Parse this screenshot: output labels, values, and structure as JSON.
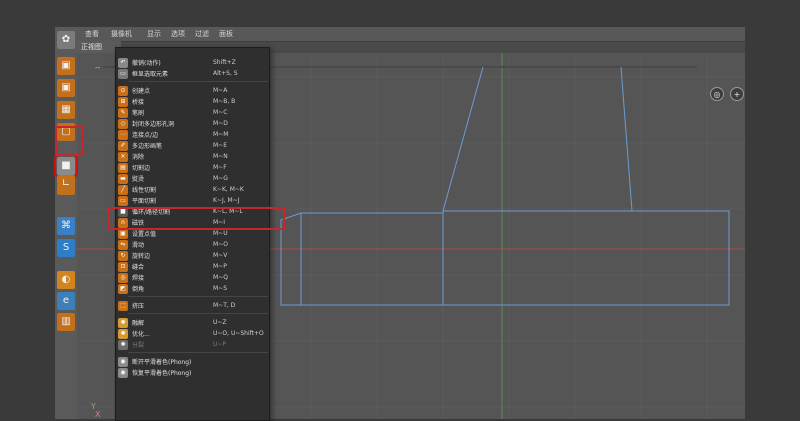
{
  "menubar": [
    "查看",
    "摄像机",
    "显示",
    "选项",
    "过滤",
    "面板"
  ],
  "view_tab": "正视图",
  "viewport": {
    "axis_label_x": "X",
    "axis_label_y": "Y",
    "nav_buttons": [
      "◎",
      "+"
    ]
  },
  "toolbar": {
    "icons": [
      {
        "name": "logo-icon",
        "color": "#7b7b7b",
        "glyph": "✿"
      },
      {
        "name": "cube-1-icon",
        "color": "#c3701d",
        "glyph": "▣"
      },
      {
        "name": "cube-2-icon",
        "color": "#c3701d",
        "glyph": "▣"
      },
      {
        "name": "grid-icon",
        "color": "#c3701d",
        "glyph": "▦"
      },
      {
        "name": "box-icon",
        "color": "#c3701d",
        "glyph": "▢"
      },
      {
        "name": "cube-tool-icon",
        "color": "#8a8a8a",
        "glyph": "■"
      },
      {
        "name": "cube-3-icon",
        "color": "#c3701d",
        "glyph": "▤"
      },
      {
        "name": "angle-icon",
        "color": "#c3701d",
        "glyph": "∟"
      },
      {
        "name": "mouse-icon",
        "color": "#3a80c9",
        "glyph": "⌘"
      },
      {
        "name": "s-icon",
        "color": "#2d7dc7",
        "glyph": "S"
      },
      {
        "name": "magnet-icon",
        "color": "#d2851f",
        "glyph": "◐"
      },
      {
        "name": "mesh-e-icon",
        "color": "#3f7fb8",
        "glyph": "e"
      },
      {
        "name": "mesh-icon",
        "color": "#c3701d",
        "glyph": "▥"
      }
    ]
  },
  "menu": {
    "items": [
      {
        "name": "undo-action",
        "label": "撤销(动作)",
        "shortcut": "Shift+Z",
        "icon_color": "#8a8a8a",
        "icon": "↶",
        "disabled": false
      },
      {
        "name": "frame-selected",
        "label": "框显选取元素",
        "shortcut": "Alt+S, S",
        "icon_color": "#7a7a7a",
        "icon": "▭",
        "disabled": false
      },
      {
        "name": "create-point",
        "label": "创建点",
        "shortcut": "M~A",
        "icon_color": "#c96f18",
        "icon": "⊙",
        "disabled": false
      },
      {
        "name": "bridge",
        "label": "桥接",
        "shortcut": "M~B, B",
        "icon_color": "#c96f18",
        "icon": "⊞",
        "disabled": false
      },
      {
        "name": "brush",
        "label": "笔刷",
        "shortcut": "M~C",
        "icon_color": "#c96f18",
        "icon": "✎",
        "disabled": false
      },
      {
        "name": "close-poly-hole",
        "label": "封闭多边形孔洞",
        "shortcut": "M~D",
        "icon_color": "#c96f18",
        "icon": "◇",
        "disabled": false
      },
      {
        "name": "connect-points-edges",
        "label": "连接点/边",
        "shortcut": "M~M",
        "icon_color": "#c96f18",
        "icon": "⋯",
        "disabled": false
      },
      {
        "name": "polygon-pen",
        "label": "多边形画笔",
        "shortcut": "M~E",
        "icon_color": "#c96f18",
        "icon": "✐",
        "disabled": false
      },
      {
        "name": "dissolve",
        "label": "消除",
        "shortcut": "M~N",
        "icon_color": "#c96f18",
        "icon": "✕",
        "disabled": false
      },
      {
        "name": "cut-edge",
        "label": "切割边",
        "shortcut": "M~F",
        "icon_color": "#c96f18",
        "icon": "▤",
        "disabled": false
      },
      {
        "name": "iron",
        "label": "熨烫",
        "shortcut": "M~G",
        "icon_color": "#c96f18",
        "icon": "▬",
        "disabled": false
      },
      {
        "name": "line-cut",
        "label": "线性切割",
        "shortcut": "K~K, M~K",
        "icon_color": "#c96f18",
        "icon": "╱",
        "disabled": false
      },
      {
        "name": "plane-cut",
        "label": "平面切割",
        "shortcut": "K~J, M~J",
        "icon_color": "#c96f18",
        "icon": "▭",
        "disabled": false
      },
      {
        "name": "loop-path-cut",
        "label": "循环/路径切割",
        "shortcut": "K~L, M~L",
        "icon_color": "#5a5a5a",
        "icon": "■",
        "disabled": false
      },
      {
        "name": "magnet",
        "label": "磁铁",
        "shortcut": "M~I",
        "icon_color": "#c96f18",
        "icon": "∩",
        "disabled": false
      },
      {
        "name": "set-point-value",
        "label": "设置点值",
        "shortcut": "M~U",
        "icon_color": "#c96f18",
        "icon": "▣",
        "disabled": false
      },
      {
        "name": "slide",
        "label": "滑动",
        "shortcut": "M~O",
        "icon_color": "#c96f18",
        "icon": "⇋",
        "disabled": false
      },
      {
        "name": "spin-edge",
        "label": "旋转边",
        "shortcut": "M~V",
        "icon_color": "#c96f18",
        "icon": "↻",
        "disabled": false
      },
      {
        "name": "stitch",
        "label": "缝合",
        "shortcut": "M~P",
        "icon_color": "#c96f18",
        "icon": "⊡",
        "disabled": false
      },
      {
        "name": "weld",
        "label": "焊接",
        "shortcut": "M~Q",
        "icon_color": "#c96f18",
        "icon": "◎",
        "disabled": false
      },
      {
        "name": "bevel",
        "label": "倒角",
        "shortcut": "M~S",
        "icon_color": "#c96f18",
        "icon": "◩",
        "disabled": false
      },
      {
        "name": "extrude",
        "label": "挤压",
        "shortcut": "M~T, D",
        "icon_color": "#c96f18",
        "icon": "⬚",
        "disabled": false
      },
      {
        "name": "melt",
        "label": "融解",
        "shortcut": "U~Z",
        "icon_color": "#d49b32",
        "icon": "✺",
        "disabled": false
      },
      {
        "name": "optimize",
        "label": "优化...",
        "shortcut": "U~O, U~Shift+O",
        "icon_color": "#d49b32",
        "icon": "✺",
        "disabled": false
      },
      {
        "name": "split",
        "label": "分裂",
        "shortcut": "U~P",
        "icon_color": "#6c6c6c",
        "icon": "✺",
        "disabled": true
      },
      {
        "name": "break-phong",
        "label": "断开平滑着色(Phong)",
        "shortcut": "",
        "icon_color": "#8a8a8a",
        "icon": "◉",
        "disabled": false
      },
      {
        "name": "restore-phong",
        "label": "恢复平滑着色(Phong)",
        "shortcut": "",
        "icon_color": "#8a8a8a",
        "icon": "◉",
        "disabled": false
      }
    ]
  }
}
